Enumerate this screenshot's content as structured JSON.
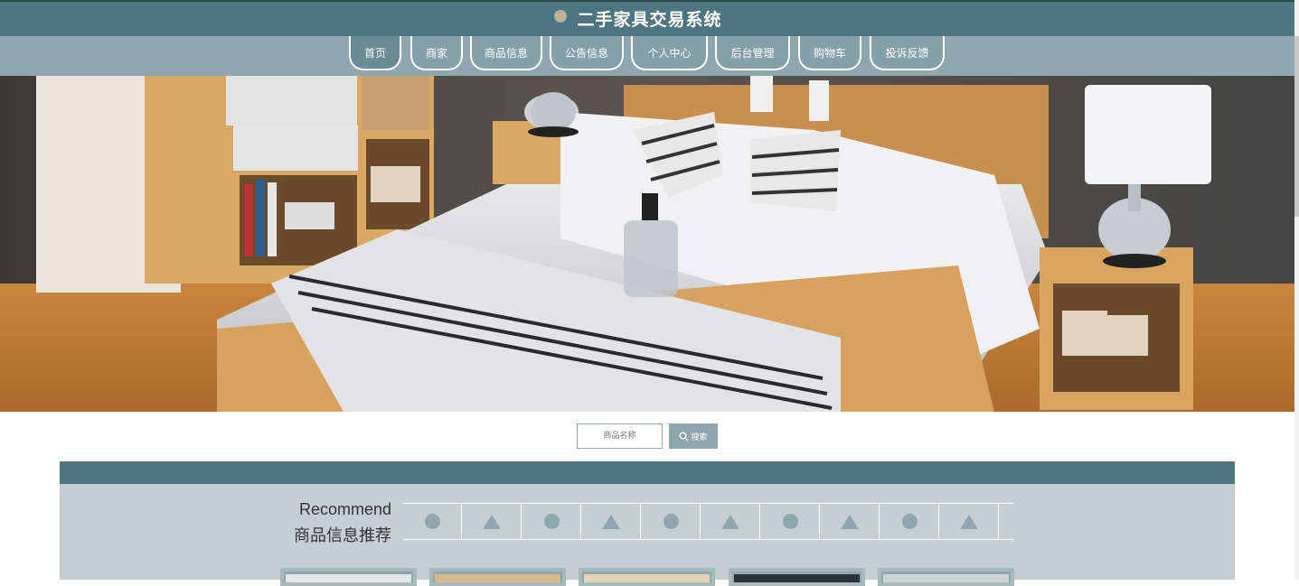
{
  "header": {
    "title": "二手家具交易系统"
  },
  "nav": {
    "items": [
      {
        "label": "首页",
        "active": true
      },
      {
        "label": "商家",
        "active": false
      },
      {
        "label": "商品信息",
        "active": false
      },
      {
        "label": "公告信息",
        "active": false
      },
      {
        "label": "个人中心",
        "active": false
      },
      {
        "label": "后台管理",
        "active": false
      },
      {
        "label": "购物车",
        "active": false
      },
      {
        "label": "投诉反馈",
        "active": false
      }
    ]
  },
  "banner": {
    "slides": 3,
    "active_slide": 2
  },
  "search": {
    "placeholder": "商品名称",
    "button_label": "搜索",
    "button_icon": "search-icon"
  },
  "recommend": {
    "title_en": "Recommend",
    "title_cn": "商品信息推荐",
    "decorations": [
      "circle",
      "triangle",
      "circle",
      "triangle",
      "circle",
      "triangle",
      "circle",
      "triangle",
      "circle",
      "triangle"
    ]
  },
  "colors": {
    "primary": "#4f7580",
    "secondary": "#8ea6ae",
    "section_bg": "#c5cfd2"
  }
}
